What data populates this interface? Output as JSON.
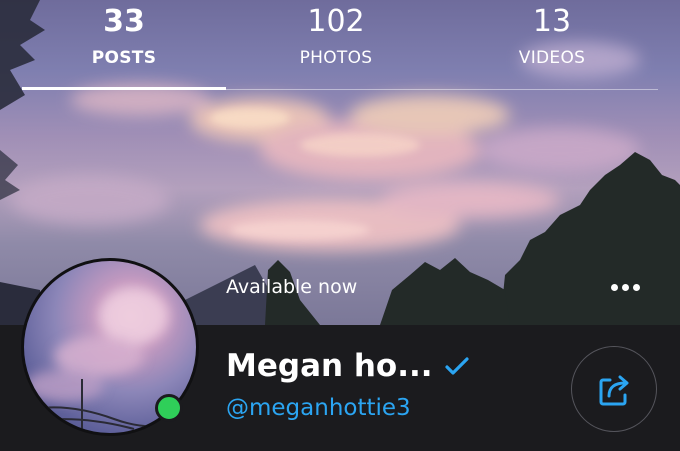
{
  "stats": [
    {
      "count": "33",
      "label": "POSTS",
      "active": true
    },
    {
      "count": "102",
      "label": "PHOTOS",
      "active": false
    },
    {
      "count": "13",
      "label": "VIDEOS",
      "active": false
    }
  ],
  "profile": {
    "status": "Available now",
    "display_name": "Megan ho...",
    "username": "@meganhottie3",
    "online": true,
    "verified": true
  },
  "icons": {
    "more": "more-horizontal-icon",
    "verified": "verified-check-icon",
    "share": "share-icon"
  },
  "colors": {
    "accent": "#2ba5f2",
    "online": "#2fcf59",
    "bar_background": "#1b1b1e"
  }
}
